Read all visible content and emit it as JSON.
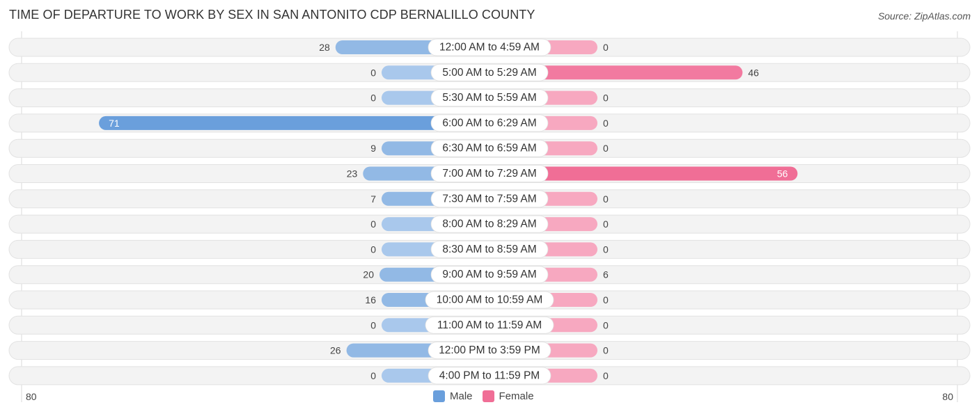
{
  "header": {
    "title": "TIME OF DEPARTURE TO WORK BY SEX IN SAN ANTONITO CDP BERNALILLO COUNTY",
    "source": "Source: ZipAtlas.com"
  },
  "legend": [
    {
      "name": "Male",
      "color": "#6a9fdc"
    },
    {
      "name": "Female",
      "color": "#f06e96"
    }
  ],
  "axis": {
    "left_label": "80",
    "right_label": "80"
  },
  "chart_data": {
    "type": "bar",
    "orientation": "horizontal-butterfly",
    "title": "TIME OF DEPARTURE TO WORK BY SEX IN SAN ANTONITO CDP BERNALILLO COUNTY",
    "categories": [
      "12:00 AM to 4:59 AM",
      "5:00 AM to 5:29 AM",
      "5:30 AM to 5:59 AM",
      "6:00 AM to 6:29 AM",
      "6:30 AM to 6:59 AM",
      "7:00 AM to 7:29 AM",
      "7:30 AM to 7:59 AM",
      "8:00 AM to 8:29 AM",
      "8:30 AM to 8:59 AM",
      "9:00 AM to 9:59 AM",
      "10:00 AM to 10:59 AM",
      "11:00 AM to 11:59 AM",
      "12:00 PM to 3:59 PM",
      "4:00 PM to 11:59 PM"
    ],
    "series": [
      {
        "name": "Male",
        "color": "#6a9fdc",
        "light_color": "#a9c8ec",
        "values": [
          28,
          0,
          0,
          71,
          9,
          23,
          7,
          0,
          0,
          20,
          16,
          0,
          26,
          0
        ]
      },
      {
        "name": "Female",
        "color": "#f06e96",
        "light_color": "#f7a8c0",
        "values": [
          0,
          46,
          0,
          0,
          0,
          56,
          0,
          0,
          0,
          6,
          0,
          0,
          0,
          0
        ]
      }
    ],
    "xlim": [
      -80,
      80
    ],
    "xlabel": "",
    "ylabel": "",
    "tick_labels": [
      "80",
      "80"
    ],
    "legend_position": "bottom-center",
    "grid": false
  }
}
